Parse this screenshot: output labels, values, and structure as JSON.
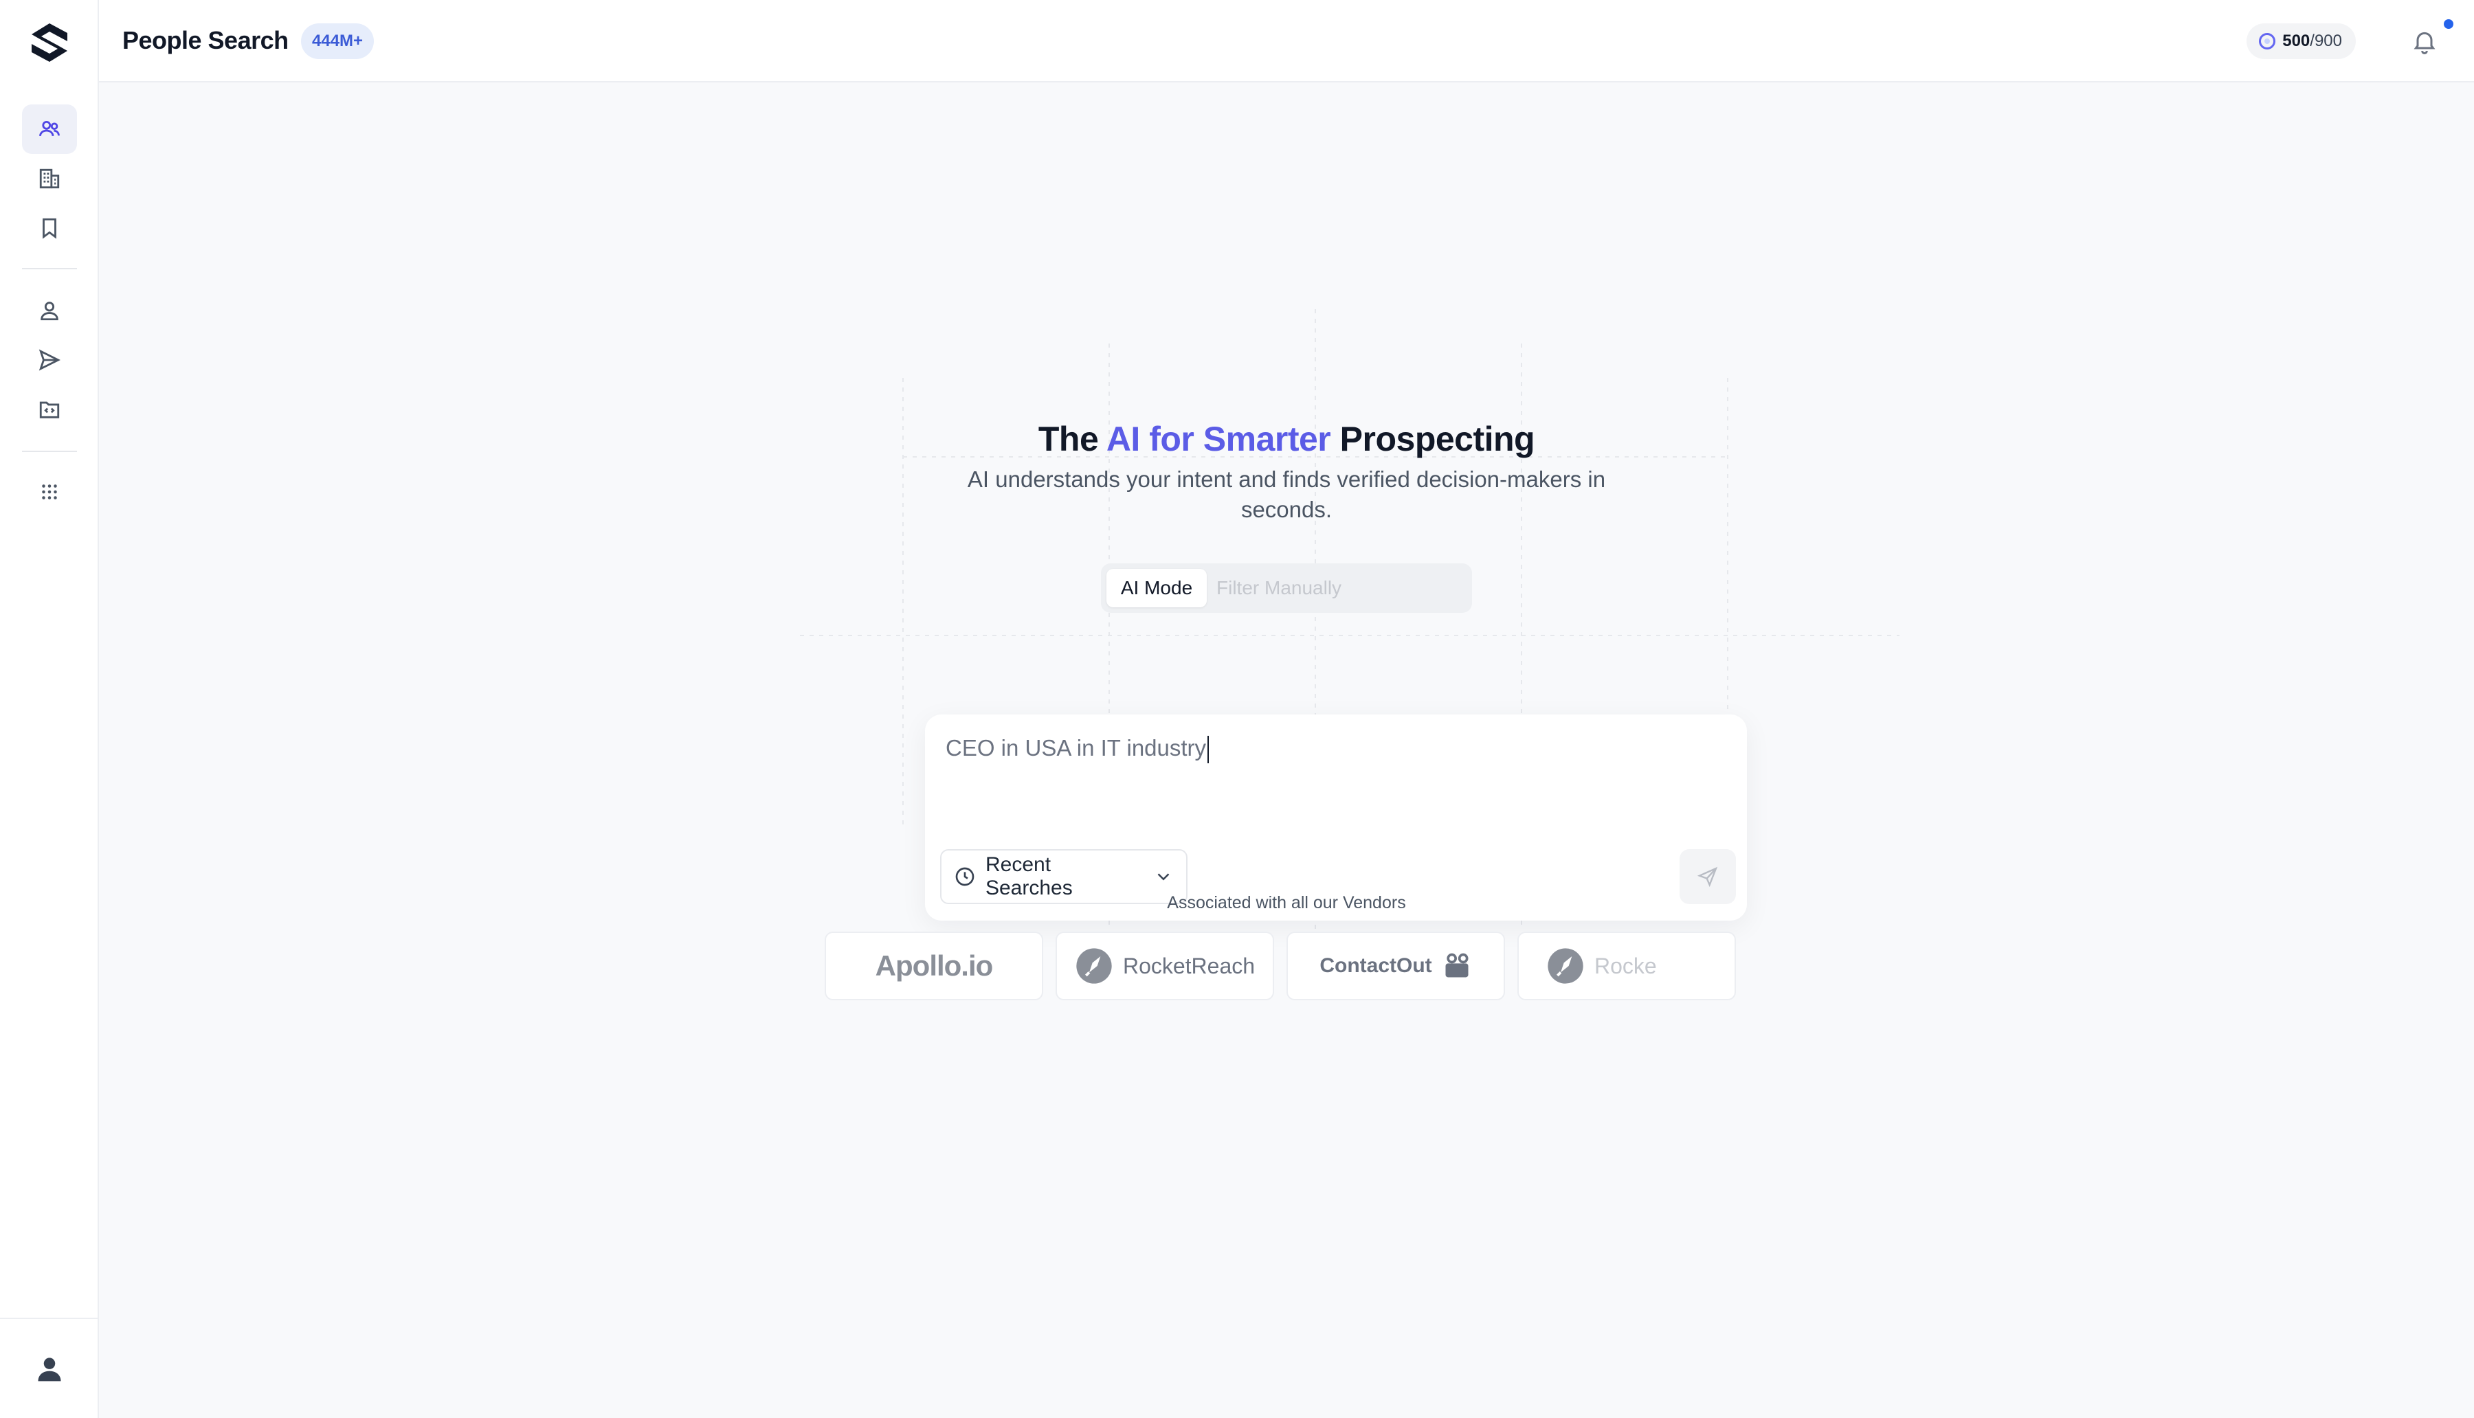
{
  "header": {
    "title": "People Search",
    "count_badge": "444M+",
    "credits_used": "500",
    "credits_total": "/900"
  },
  "sidebar": {
    "items": [
      {
        "name": "people",
        "icon": "users-icon",
        "active": true
      },
      {
        "name": "companies",
        "icon": "building-icon",
        "active": false
      },
      {
        "name": "saved",
        "icon": "bookmark-icon",
        "active": false
      },
      {
        "name": "contacts",
        "icon": "user-icon",
        "active": false
      },
      {
        "name": "sequences",
        "icon": "send-icon",
        "active": false
      },
      {
        "name": "integrations",
        "icon": "folder-code-icon",
        "active": false
      },
      {
        "name": "apps",
        "icon": "grid-icon",
        "active": false
      }
    ]
  },
  "hero": {
    "title_prefix": "The ",
    "title_accent": "AI for Smarter",
    "title_suffix": " Prospecting",
    "subtitle": "AI understands your intent and finds verified decision-makers in seconds."
  },
  "modes": {
    "ai": "AI Mode",
    "manual": "Filter Manually"
  },
  "search": {
    "query": "CEO in USA in IT industry",
    "recent_label": "Recent Searches"
  },
  "vendors": {
    "label": "Associated with all our Vendors",
    "items": [
      "Apollo.io",
      "RocketReach",
      "ContactOut",
      "Rocke"
    ]
  },
  "colors": {
    "accent": "#5b5ce6",
    "badge_bg": "#e6edfb",
    "badge_text": "#3b5bd6",
    "notification_dot": "#2563eb"
  }
}
